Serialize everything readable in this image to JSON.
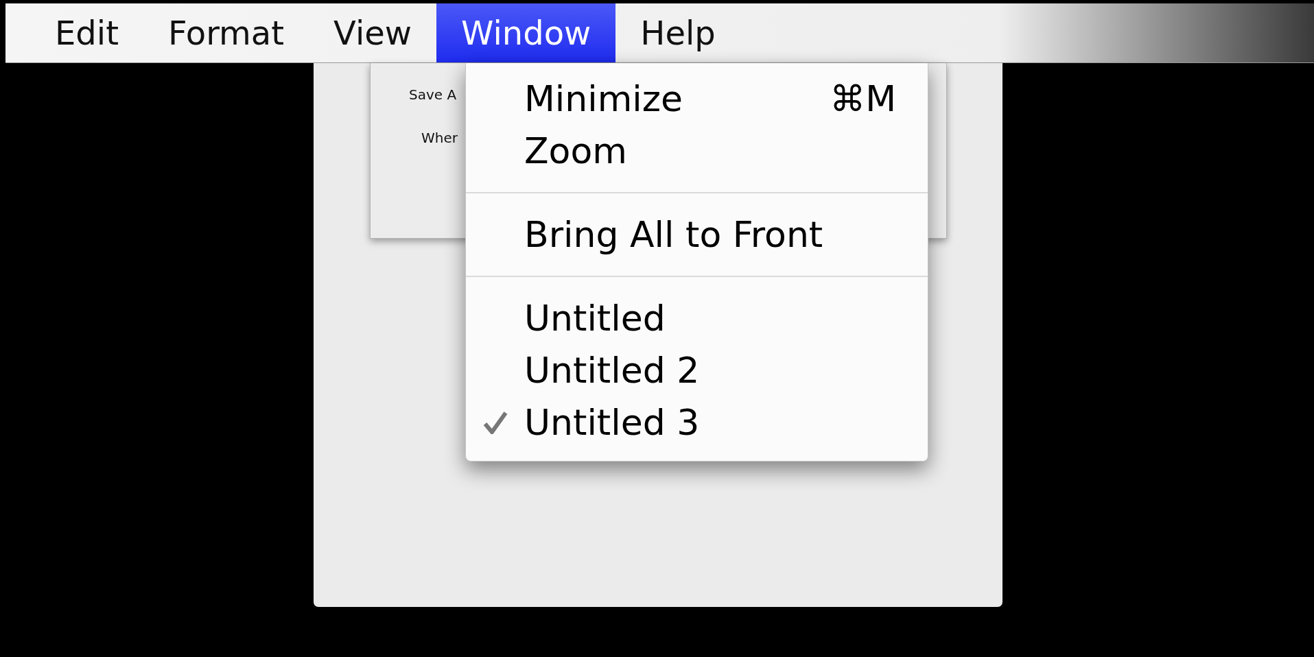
{
  "menubar": {
    "items": [
      {
        "label": "Edit",
        "selected": false
      },
      {
        "label": "Format",
        "selected": false
      },
      {
        "label": "View",
        "selected": false
      },
      {
        "label": "Window",
        "selected": true
      },
      {
        "label": "Help",
        "selected": false
      }
    ]
  },
  "save_sheet": {
    "save_as_label": "Save A",
    "where_label": "Wher"
  },
  "window_menu": {
    "items": [
      {
        "kind": "item",
        "label": "Minimize",
        "shortcut": "⌘M",
        "checked": false
      },
      {
        "kind": "item",
        "label": "Zoom",
        "checked": false
      },
      {
        "kind": "separator"
      },
      {
        "kind": "item",
        "label": "Bring All to Front",
        "checked": false
      },
      {
        "kind": "separator"
      },
      {
        "kind": "item",
        "label": "Untitled",
        "checked": false
      },
      {
        "kind": "item",
        "label": "Untitled 2",
        "checked": false
      },
      {
        "kind": "item",
        "label": "Untitled 3",
        "checked": true
      }
    ]
  }
}
